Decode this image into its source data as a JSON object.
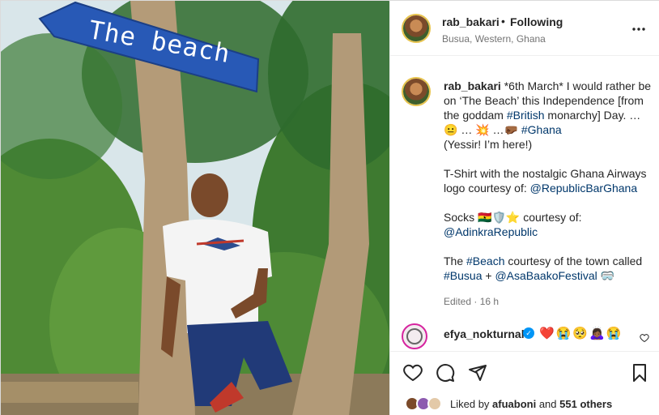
{
  "photo": {
    "sign_text": "The beach",
    "alt": "Man in white star T-shirt leaning on a palm tree under a blue sign"
  },
  "header": {
    "username": "rab_bakari",
    "separator": "•",
    "follow_status": "Following",
    "location": "Busua, Western, Ghana",
    "more_icon": "more-horizontal-icon"
  },
  "caption": {
    "username": "rab_bakari",
    "lines": [
      "*6th March* I would rather be",
      "on ‘The Beach’ this Independence [from",
      "the goddam ",
      "(Yessir! I’m here!)",
      "T-Shirt with the nostalgic Ghana Airways",
      "logo courtesy of: ",
      "Socks ",
      " courtesy of:",
      "The ",
      " courtesy of the town called",
      " + "
    ],
    "tags": {
      "british": "#British",
      "ghana": "#Ghana",
      "republic_bar": "@RepublicBarGhana",
      "adinkra": "@AdinkraRepublic",
      "beach": "#Beach",
      "busua": "#Busua",
      "festival": "@AsaBaakoFestival"
    },
    "monarchy_text": " monarchy] Day. …",
    "emoji_line": "😐 … 💥 …🤛🏾 ",
    "socks_emojis": "🇬🇭🛡️⭐",
    "end_emoji": "🥽",
    "edited": "Edited · 16 h"
  },
  "comment": {
    "username": "efya_nokturnal",
    "emojis": "❤️😭🥺🙇🏾‍♀️😭",
    "verified_mark": "✓"
  },
  "actions": {
    "like": "heart-icon",
    "comment": "comment-icon",
    "share": "share-icon",
    "save": "bookmark-icon"
  },
  "likes": {
    "prefix": "Liked by ",
    "user": "afuaboni",
    "middle": " and ",
    "others": "551 others"
  },
  "colors": {
    "sign_blue": "#2859b6",
    "hashtag": "#00376b",
    "verified": "#0095f6",
    "story_ring": "#d6249f"
  }
}
